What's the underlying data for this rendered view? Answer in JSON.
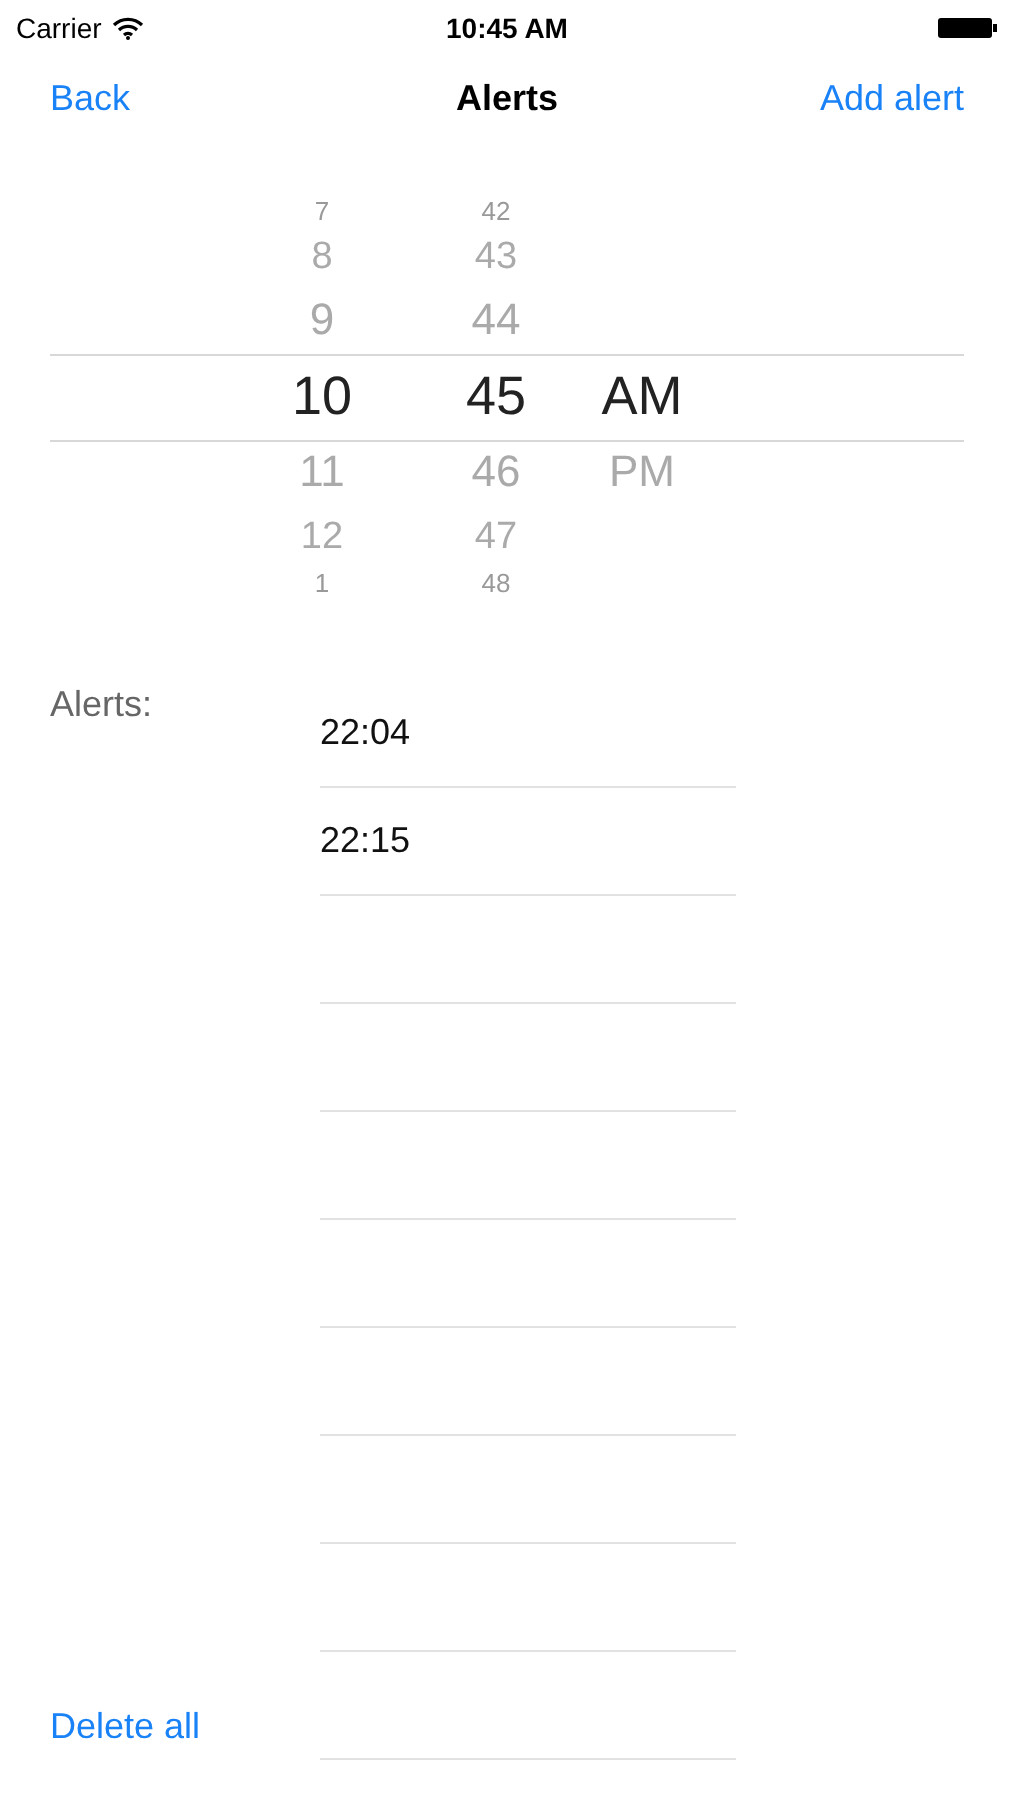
{
  "status_bar": {
    "carrier": "Carrier",
    "time": "10:45 AM"
  },
  "nav": {
    "back": "Back",
    "title": "Alerts",
    "action": "Add alert"
  },
  "picker": {
    "columns": [
      {
        "items": [
          {
            "label": "7",
            "selected": false
          },
          {
            "label": "8",
            "selected": false
          },
          {
            "label": "9",
            "selected": false
          },
          {
            "label": "10",
            "selected": true
          },
          {
            "label": "11",
            "selected": false
          },
          {
            "label": "12",
            "selected": false
          },
          {
            "label": "1",
            "selected": false
          }
        ]
      },
      {
        "items": [
          {
            "label": "42",
            "selected": false
          },
          {
            "label": "43",
            "selected": false
          },
          {
            "label": "44",
            "selected": false
          },
          {
            "label": "45",
            "selected": true
          },
          {
            "label": "46",
            "selected": false
          },
          {
            "label": "47",
            "selected": false
          },
          {
            "label": "48",
            "selected": false
          }
        ]
      },
      {
        "items": [
          {
            "label": "AM",
            "selected": true
          },
          {
            "label": "PM",
            "selected": false
          }
        ]
      }
    ]
  },
  "alerts": {
    "label": "Alerts:",
    "rows": [
      "22:04",
      "22:15"
    ]
  },
  "delete_all": "Delete all"
}
